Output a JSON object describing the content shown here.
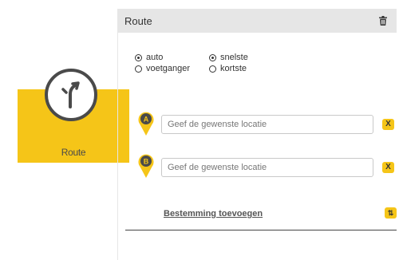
{
  "tile": {
    "label": "Route",
    "icon": "route-fork-icon"
  },
  "panel": {
    "title": "Route",
    "delete_icon": "trash-icon"
  },
  "modes": [
    {
      "label": "auto",
      "checked": true
    },
    {
      "label": "voetganger",
      "checked": false
    }
  ],
  "preferences": [
    {
      "label": "snelste",
      "checked": true
    },
    {
      "label": "kortste",
      "checked": false
    }
  ],
  "locations": [
    {
      "marker": "A",
      "placeholder": "Geef de gewenste locatie",
      "value": "",
      "clear_label": "X"
    },
    {
      "marker": "B",
      "placeholder": "Geef de gewenste locatie",
      "value": "",
      "clear_label": "X"
    }
  ],
  "actions": {
    "add_destination": "Bestemming toevoegen",
    "swap_label": "⇅"
  },
  "colors": {
    "accent": "#f5c518",
    "dark": "#4a4a4a",
    "header_bg": "#e6e6e6"
  }
}
